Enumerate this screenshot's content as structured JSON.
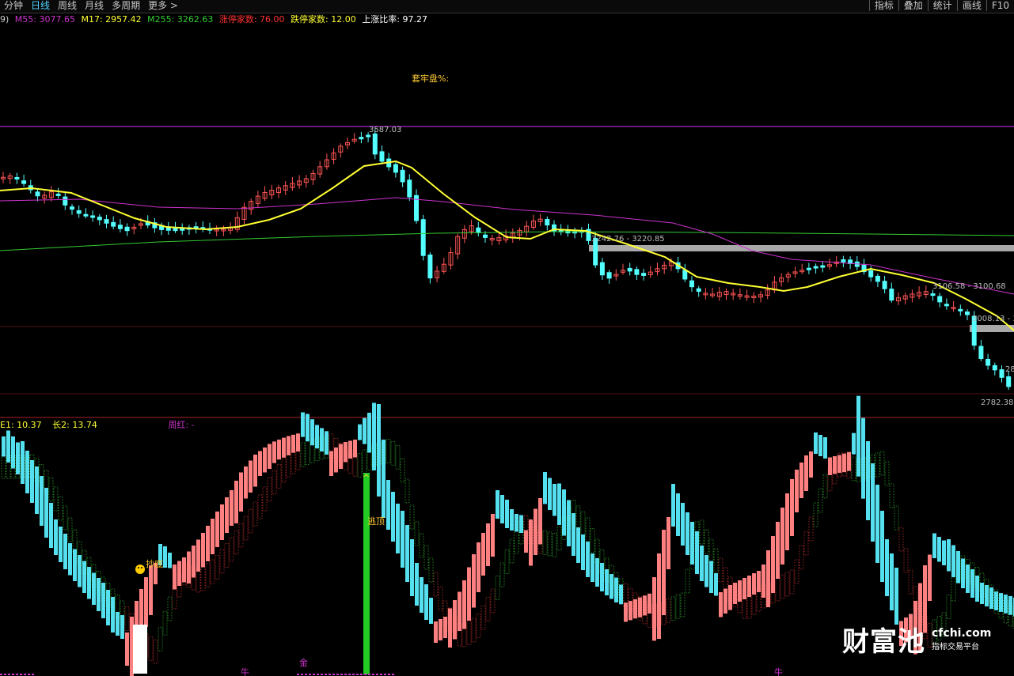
{
  "toolbar": {
    "left": [
      "分钟",
      "日线",
      "周线",
      "月线",
      "多周期",
      "更多 >"
    ],
    "active_index": 1,
    "right": [
      "指标",
      "叠加",
      "统计",
      "画线",
      "F10"
    ]
  },
  "info": {
    "prefix": "9)",
    "m55": "M55: 3077.65",
    "m17": "M17: 2957.42",
    "m255": "M255: 3262.63",
    "limit_up": "涨停家数: 76.00",
    "limit_down": "跌停家数: 12.00",
    "up_ratio": "上涨比率: 97.27",
    "trapped": "套牢盘%:"
  },
  "price_labels": {
    "high": "3587.03",
    "range1": "3242.76 - 3220.85",
    "range2": "3106.58 - 3100.68",
    "range3": "3008.13 - 3",
    "partial": "28",
    "low": "2782.38"
  },
  "sub_info": {
    "long1": "E1: 10.37",
    "long2": "长2: 13.74",
    "zhouhong": "周红: -"
  },
  "markers": {
    "buy": "抄底",
    "escape": "逃顶",
    "gold": "金",
    "niu1": "牛",
    "niu2": "牛",
    "arrow": "^"
  },
  "logo": {
    "name": "财富池",
    "url": "cfchi.com",
    "subtitle": "指标交易平台"
  },
  "colors": {
    "up": "#ff5555",
    "down": "#54ffff",
    "ma_yellow": "#ffff33",
    "ma_magenta": "#cc33cc",
    "ma_green": "#33cc33",
    "separator": "#aa2222",
    "hline": "#cc33ff"
  }
}
